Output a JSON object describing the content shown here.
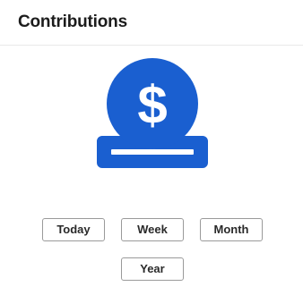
{
  "header": {
    "title": "Contributions"
  },
  "illustration": {
    "icon": "coin-deposit-icon",
    "color": "#1a5fd0",
    "symbol": "$"
  },
  "range_buttons": {
    "today": "Today",
    "week": "Week",
    "month": "Month",
    "year": "Year"
  }
}
